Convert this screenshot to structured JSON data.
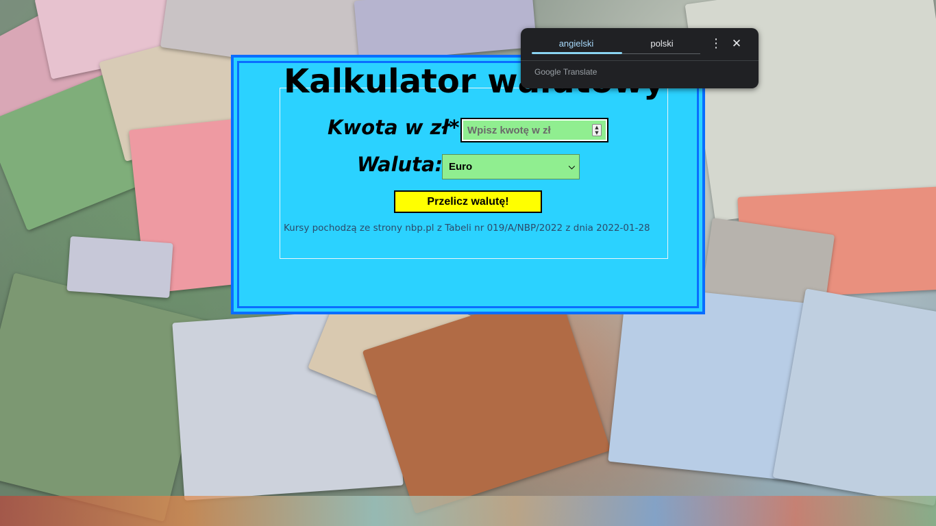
{
  "calculator": {
    "title": "Kalkulator walutowy",
    "amount_label": "Kwota w zł*:",
    "amount_placeholder": "Wpisz kwotę w zł",
    "amount_value": "",
    "currency_label": "Waluta:",
    "currency_selected": "Euro",
    "convert_button": "Przelicz walutę!",
    "rates_note": "Kursy pochodzą ze strony nbp.pl z Tabeli nr 019/A/NBP/2022 z dnia 2022-01-28"
  },
  "translate_popup": {
    "tabs": [
      "angielski",
      "polski"
    ],
    "active_tab": "angielski",
    "brand": "Google Translate",
    "icons": {
      "more": "more-vert-icon",
      "close": "close-icon"
    }
  },
  "colors": {
    "panel_bg": "#2bd2ff",
    "panel_border": "#0a6dff",
    "input_bg": "#90ee90",
    "button_bg": "#ffff00",
    "popup_bg": "#202124"
  }
}
